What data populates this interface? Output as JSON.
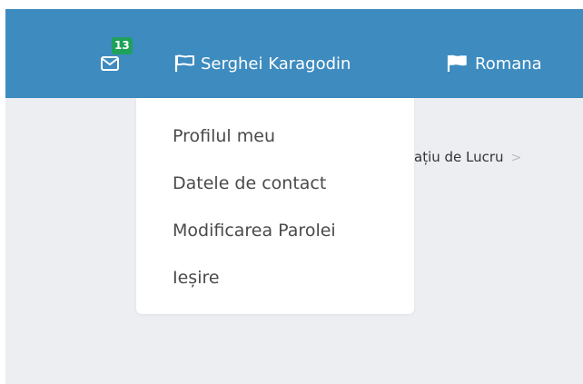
{
  "header": {
    "notifications_count": "13",
    "user_name": "Serghei Karagodin",
    "language": "Romana"
  },
  "breadcrumb": {
    "current": "ațiu de Lucru",
    "separator": ">"
  },
  "user_dropdown": {
    "items": [
      {
        "label": "Profilul meu"
      },
      {
        "label": "Datele de contact"
      },
      {
        "label": "Modificarea Parolei"
      },
      {
        "label": "Ieșire"
      }
    ]
  },
  "colors": {
    "header_bg": "#3d8bbf",
    "badge_bg": "#1fa15b",
    "page_bg": "#eceef2"
  },
  "icons": {
    "mail": "envelope-icon",
    "user": "flag-outline-icon",
    "language": "flag-solid-icon"
  }
}
